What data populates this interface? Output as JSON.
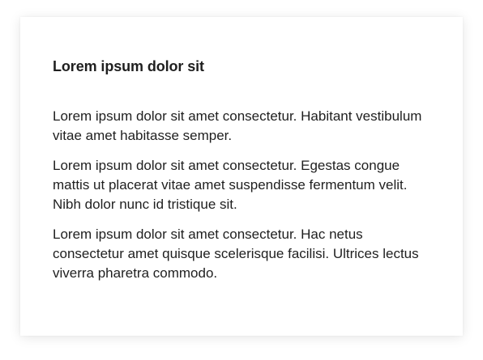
{
  "card": {
    "title": "Lorem ipsum dolor sit",
    "paragraphs": [
      "Lorem ipsum dolor sit amet consectetur. Habitant vestibulum vitae amet habitasse semper.",
      "Lorem ipsum dolor sit amet consectetur. Egestas congue mattis ut placerat vitae amet suspendisse fermentum velit. Nibh dolor nunc id tristique sit.",
      "Lorem ipsum dolor sit amet consectetur. Hac netus consectetur amet quisque scelerisque facilisi. Ultrices lectus viverra pharetra commodo."
    ]
  }
}
